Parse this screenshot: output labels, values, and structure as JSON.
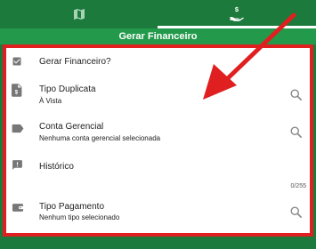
{
  "tabs": [
    {
      "icon": "map-icon",
      "active": false
    },
    {
      "icon": "hand-money-icon",
      "active": true
    }
  ],
  "header": {
    "title": "Gerar Financeiro"
  },
  "rows": [
    {
      "icon": "checkbox-checked-icon",
      "label": "Gerar Financeiro?"
    },
    {
      "icon": "document-dollar-icon",
      "label": "Tipo Duplicata",
      "value": "À Vista"
    },
    {
      "icon": "label-tag-icon",
      "label": "Conta Gerencial",
      "value": "Nenhuma conta gerencial selecionada"
    },
    {
      "icon": "comment-alert-icon",
      "label": "Histórico",
      "counter": "0/255"
    },
    {
      "icon": "wallet-icon",
      "label": "Tipo Pagamento",
      "value": "Nenhum tipo selecionado"
    }
  ],
  "colors": {
    "primary": "#1b7a3c",
    "title_bar": "#239a4b",
    "highlight": "#e02020"
  }
}
